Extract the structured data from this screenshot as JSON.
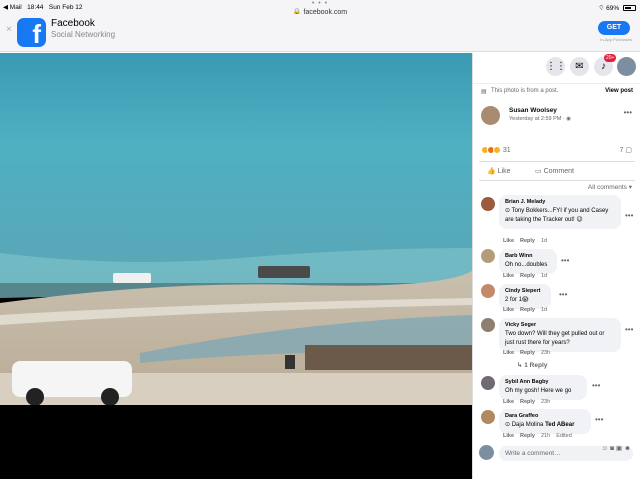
{
  "statusbar": {
    "back_app": "◀ Mail",
    "time": "18:44",
    "date": "Sun Feb 12",
    "url": "facebook.com",
    "wifi": "wifi",
    "battery": "69%"
  },
  "banner": {
    "close": "×",
    "app_name": "Facebook",
    "category": "Social Networking",
    "get": "GET",
    "in_app": "In-App Purchases"
  },
  "viewer": {
    "close": "✕",
    "tools": [
      "zoom-in",
      "zoom-out",
      "tag",
      "fullscreen"
    ]
  },
  "panel": {
    "notification_count": "20+",
    "from_post": "This photo is from a post.",
    "view_post": "View post",
    "post": {
      "author": "Susan Woolsey",
      "time": "Yesterday at 2:59 PM · ◉",
      "reaction_count": "31",
      "share_count": "7",
      "like": "Like",
      "comment": "Comment"
    },
    "all_comments": "All comments ▾",
    "comments": [
      {
        "name": "Brian J. Melady",
        "tag": "Tony Bokkers",
        "text": "...FYI if you and Casey are taking the Tracker out! 😉",
        "like": "Like",
        "reply": "Reply",
        "time": "1d",
        "edited": ""
      },
      {
        "name": "Barb Winn",
        "tag": "",
        "text": "Oh no...doubles",
        "like": "Like",
        "reply": "Reply",
        "time": "1d",
        "edited": ""
      },
      {
        "name": "Cindy Siepert",
        "tag": "",
        "text": "2 for 1😱",
        "like": "Like",
        "reply": "Reply",
        "time": "1d",
        "edited": ""
      },
      {
        "name": "Vicky Seger",
        "tag": "",
        "text": "Two down? Will they get pulled out or just rust there for years?",
        "like": "Like",
        "reply": "Reply",
        "time": "23h",
        "edited": ""
      },
      {
        "name": "Sybil Ann Bagby",
        "tag": "",
        "text": "Oh my gosh! Here we go",
        "like": "Like",
        "reply": "Reply",
        "time": "23h",
        "edited": ""
      },
      {
        "name": "Dara Graffeo",
        "tag": "Daja Molina",
        "text": "Ted ABear",
        "like": "Like",
        "reply": "Reply",
        "time": "21h",
        "edited": "Edited"
      }
    ],
    "reply_count": "↳ 1 Reply",
    "write_placeholder": "Write a comment…"
  }
}
